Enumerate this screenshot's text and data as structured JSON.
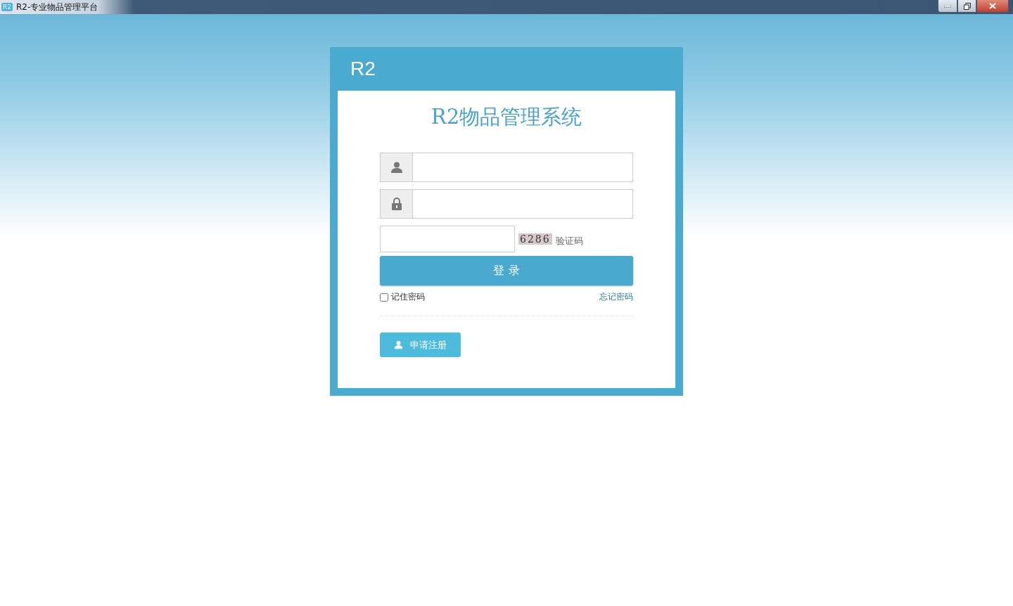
{
  "window": {
    "logo": "R2",
    "title": "R2-专业物品管理平台"
  },
  "card": {
    "brand": "R2",
    "heading": "R2物品管理系统"
  },
  "form": {
    "captcha": {
      "code": "6286",
      "label": "验证码"
    },
    "login_button": "登 录",
    "remember": {
      "label": "记住密码",
      "checked": false
    },
    "forgot_link": "忘记密码",
    "register_button": "申请注册"
  }
}
